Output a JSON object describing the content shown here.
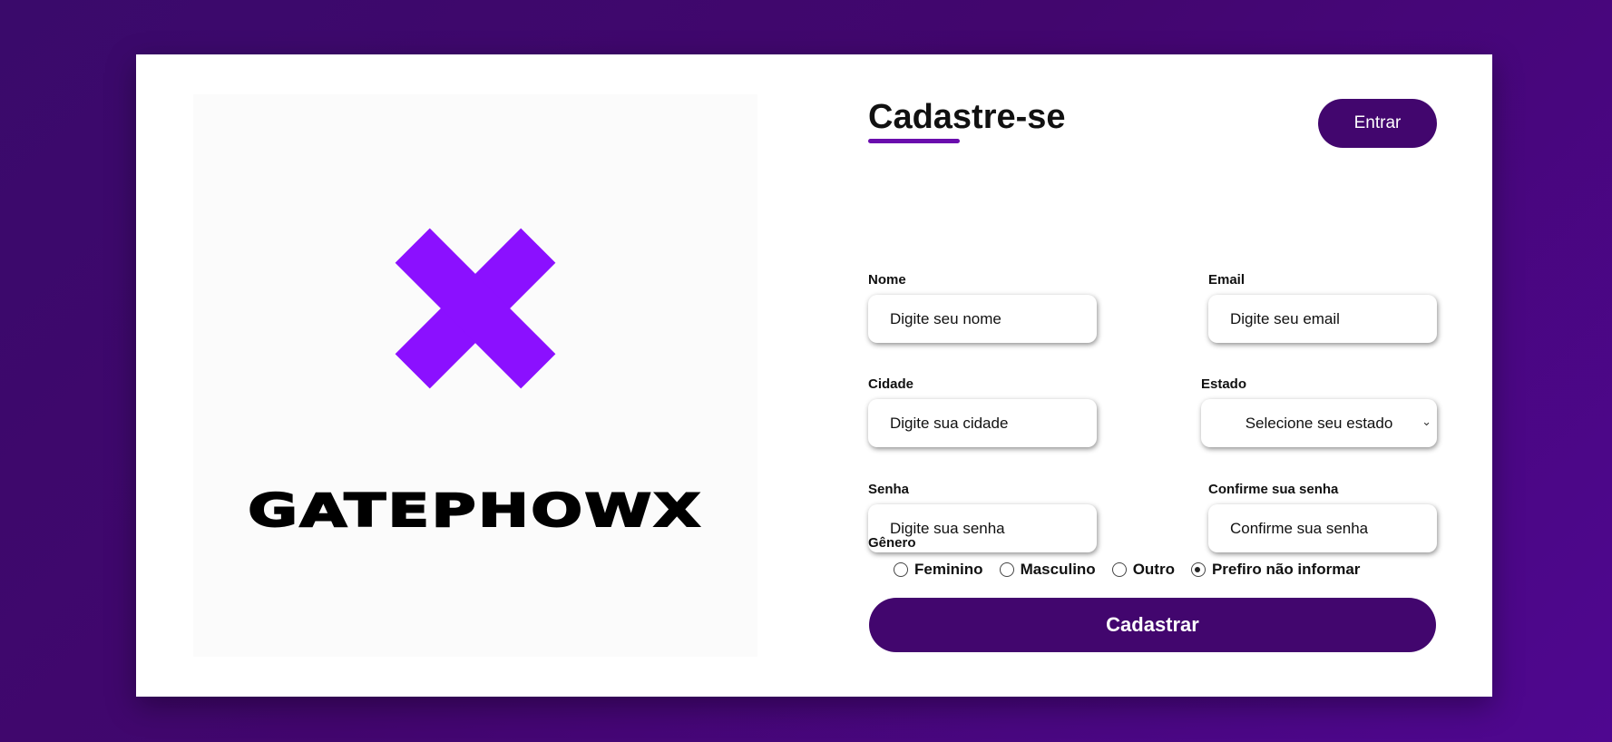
{
  "brand": {
    "name": "GATEPHOWX",
    "icon": "x-logo-icon",
    "accent_color": "#8B10FF"
  },
  "header": {
    "title": "Cadastre-se",
    "login_label": "Entrar"
  },
  "form": {
    "name": {
      "label": "Nome",
      "placeholder": "Digite seu nome"
    },
    "email": {
      "label": "Email",
      "placeholder": "Digite seu email"
    },
    "city": {
      "label": "Cidade",
      "placeholder": "Digite sua cidade"
    },
    "state": {
      "label": "Estado",
      "selected": "Selecione seu estado"
    },
    "password": {
      "label": "Senha",
      "placeholder": "Digite sua senha"
    },
    "confirm_password": {
      "label": "Confirme sua senha",
      "placeholder": "Confirme sua senha"
    },
    "gender": {
      "label": "Gênero",
      "options": [
        "Feminino",
        "Masculino",
        "Outro",
        "Prefiro não informar"
      ],
      "selected": "Prefiro não informar"
    },
    "submit_label": "Cadastrar"
  },
  "colors": {
    "primary": "#42066E",
    "background_start": "#3A0A6B",
    "background_end": "#4F0790"
  }
}
